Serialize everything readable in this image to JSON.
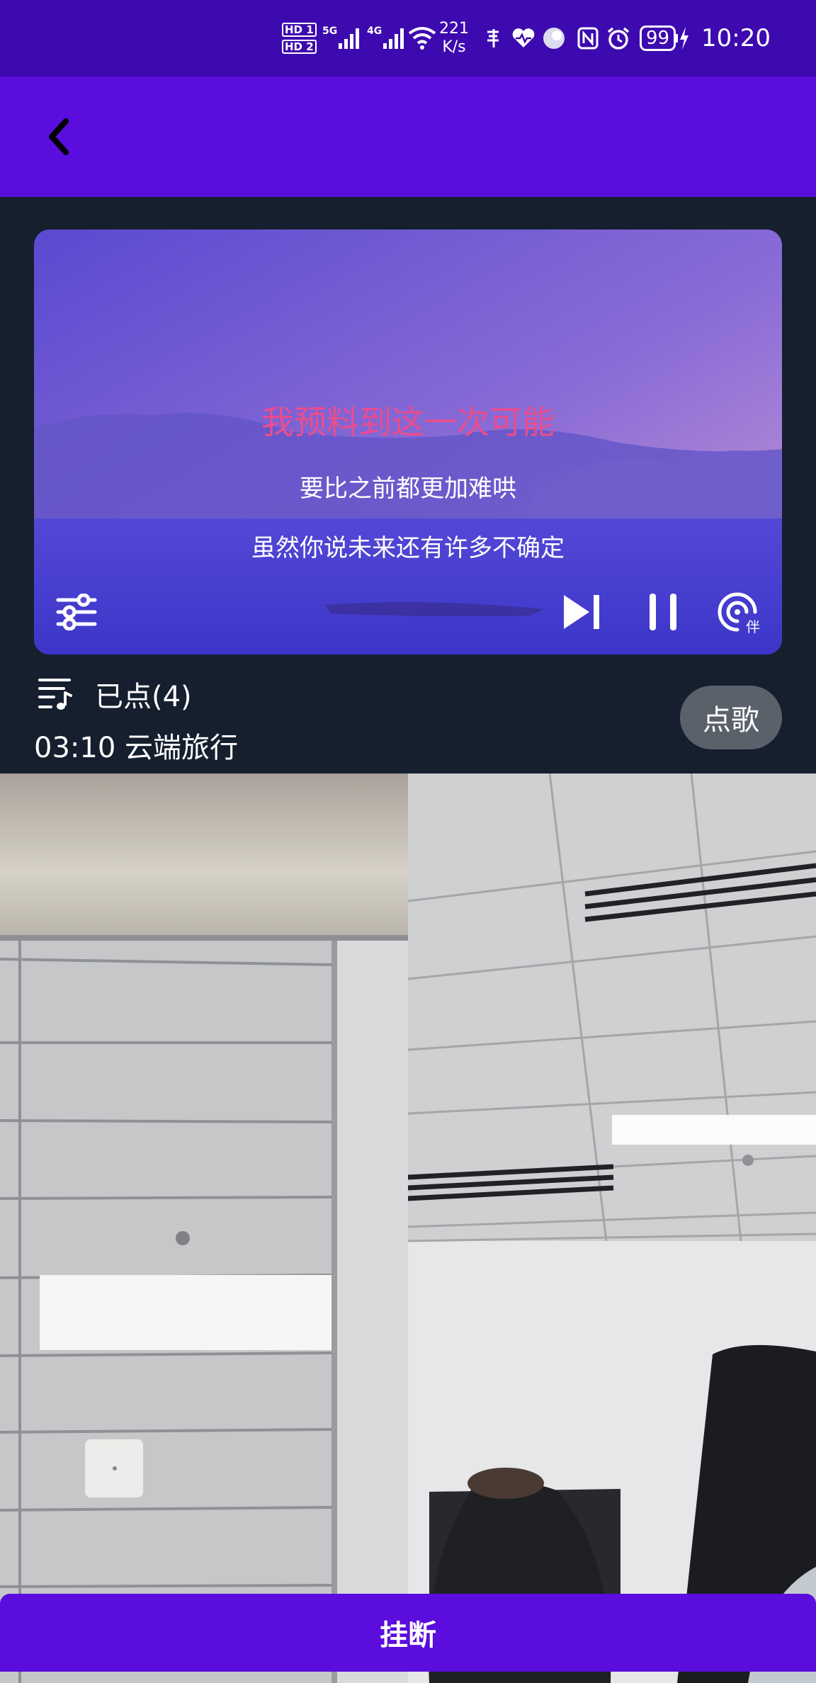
{
  "status_bar": {
    "hd1": "HD 1",
    "hd2": "HD 2",
    "signal1": "5G",
    "signal2": "4G",
    "speed_value": "221",
    "speed_unit": "K/s",
    "battery": "99",
    "time": "10:20",
    "icons": [
      "sim-5g-icon",
      "sim-4g-icon",
      "wifi-icon",
      "hotspot-icon",
      "health-icon",
      "assistant-icon",
      "nfc-icon",
      "alarm-icon",
      "battery-icon",
      "charging-icon"
    ]
  },
  "header": {
    "back_icon": "chevron-left-icon"
  },
  "player": {
    "lyric_current": "我预料到这一次可能",
    "lyric_next": "要比之前都更加难哄",
    "lyric_next2": "虽然你说未来还有许多不确定",
    "controls": [
      "settings-sliders-icon",
      "skip-next-icon",
      "pause-icon",
      "accompaniment-icon"
    ],
    "accompaniment_badge": "伴"
  },
  "queue": {
    "label": "已点(4)",
    "now_playing": "03:10 云端旅行",
    "request_button": "点歌"
  },
  "call": {
    "hangup_label": "挂断"
  },
  "colors": {
    "status_bar": "#3d0ab0",
    "header": "#5a0ddd",
    "background": "#151f2e",
    "lyric_highlight": "#e94d8e",
    "request_button": "#5b616b"
  }
}
